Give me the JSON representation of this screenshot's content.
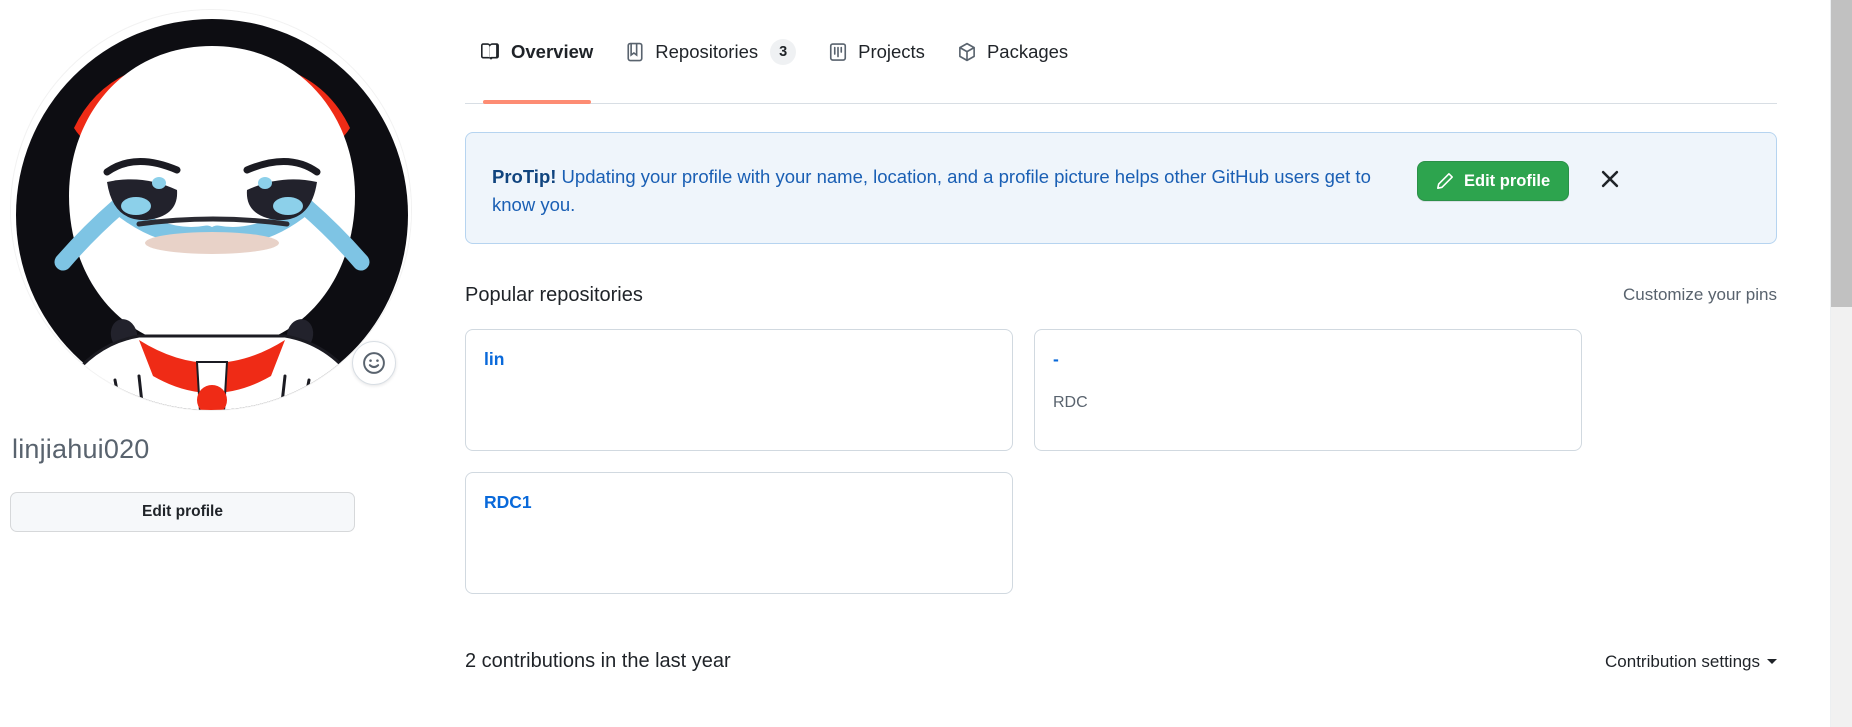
{
  "profile": {
    "username": "linjiahui020",
    "edit_profile_label": "Edit profile",
    "status_icon": "smiley-icon",
    "avatar_alt": "linjiahui020 avatar"
  },
  "tabs": [
    {
      "label": "Overview",
      "icon": "book-icon",
      "count": null,
      "selected": true
    },
    {
      "label": "Repositories",
      "icon": "repo-icon",
      "count": "3",
      "selected": false
    },
    {
      "label": "Projects",
      "icon": "project-icon",
      "count": null,
      "selected": false
    },
    {
      "label": "Packages",
      "icon": "package-icon",
      "count": null,
      "selected": false
    }
  ],
  "protip": {
    "lead": "ProTip!",
    "body": " Updating your profile with your name, location, and a profile picture helps other GitHub users get to know you.",
    "edit_profile_label": "Edit profile",
    "edit_profile_icon": "pencil-icon",
    "dismiss_icon": "close-icon"
  },
  "popular": {
    "title": "Popular repositories",
    "customize_label": "Customize your pins",
    "repos": [
      {
        "name": "lin",
        "description": ""
      },
      {
        "name": "-",
        "description": "RDC"
      },
      {
        "name": "RDC1",
        "description": ""
      }
    ]
  },
  "contributions": {
    "title": "2 contributions in the last year",
    "settings_label": "Contribution settings"
  },
  "colors": {
    "accent_blue": "#0969da",
    "tab_underline": "#fd8c73",
    "green_button": "#2da44e",
    "protip_bg": "#eff5fb",
    "protip_border": "#b6d4f0",
    "protip_text": "#1a5fb4",
    "muted_text": "#59636e",
    "border": "#d1d9e0"
  }
}
